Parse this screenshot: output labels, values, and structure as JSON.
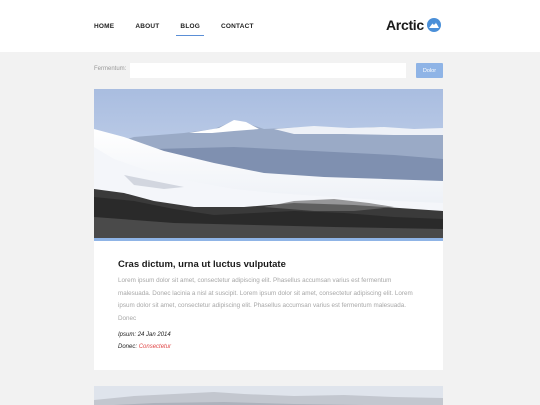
{
  "header": {
    "nav": [
      "HOME",
      "ABOUT",
      "BLOG",
      "CONTACT"
    ],
    "active_nav": "BLOG",
    "logo_text": "Arctic",
    "logo_icon": "mountain-circle-icon"
  },
  "search": {
    "label": "Fermentum:",
    "value": "",
    "button_label": "Dolor"
  },
  "post": {
    "title": "Cras dictum, urna ut luctus vulputate",
    "body": "Lorem ipsum dolor sit amet, consectetur adipiscing elit. Phasellus accumsan varius est fermentum malesuada. Donec lacinia a nisl at suscipit. Lorem ipsum dolor sit amet, consectetur adipiscing elit. Lorem ipsum dolor sit amet, consectetur adipiscing elit. Phasellus accumsan varius est fermentum malesuada. Donec",
    "date_label": "Ipsum:",
    "date_value": "24 Jan 2014",
    "author_label": "Donec:",
    "author_link": "Consectetur"
  },
  "colors": {
    "accent": "#8fb4e6",
    "link": "#e04848"
  }
}
